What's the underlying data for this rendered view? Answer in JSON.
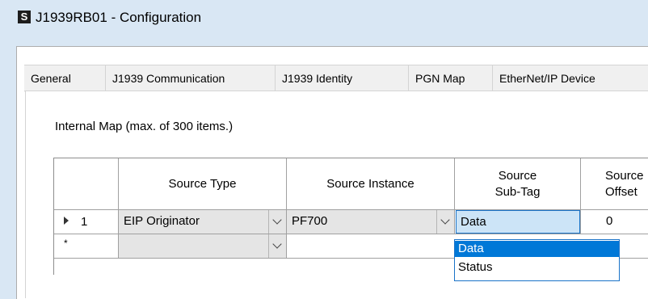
{
  "window": {
    "title": "J1939RB01 - Configuration",
    "icon": "S"
  },
  "tabs": [
    {
      "label": "General"
    },
    {
      "label": "J1939 Communication"
    },
    {
      "label": "J1939 Identity"
    },
    {
      "label": "PGN Map"
    },
    {
      "label": "EtherNet/IP Device"
    }
  ],
  "panel": {
    "caption": "Internal Map (max. of 300 items.)"
  },
  "grid": {
    "headers": {
      "source_type": "Source Type",
      "source_instance": "Source Instance",
      "source_subtag_1": "Source",
      "source_subtag_2": "Sub-Tag",
      "source_offset_1": "Source",
      "source_offset_2": "Offset"
    },
    "rows": [
      {
        "num": "1",
        "source_type": "EIP Originator",
        "source_instance": "PF700",
        "sub_tag": "Data",
        "offset": "0"
      },
      {
        "marker": "*",
        "source_type": "",
        "source_instance": ""
      }
    ]
  },
  "subtag_dropdown": {
    "options": [
      "Data",
      "Status"
    ],
    "selected": "Data"
  },
  "colors": {
    "title_bg": "#d9e7f4",
    "accent": "#0078d7",
    "active_cell": "#cce4f7"
  }
}
